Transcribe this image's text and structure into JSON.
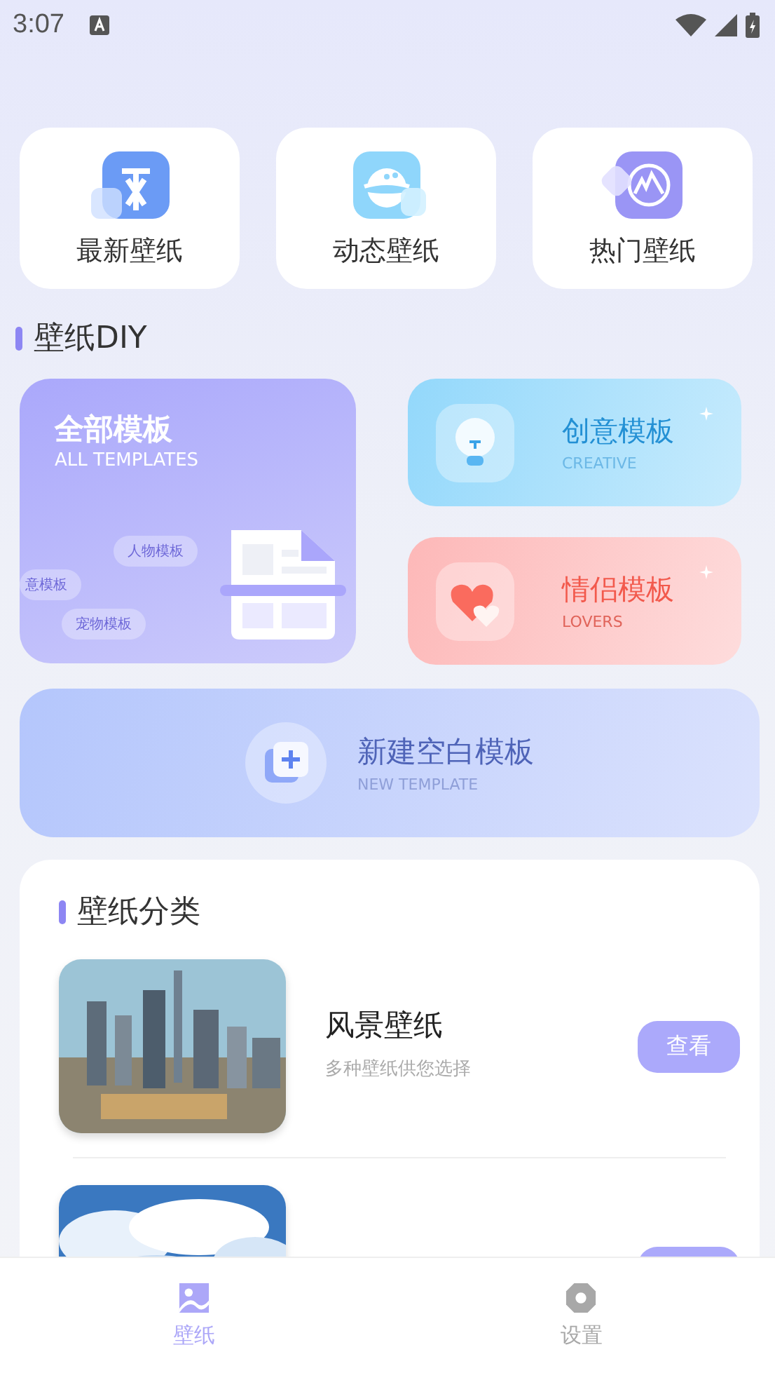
{
  "status_bar": {
    "time": "3:07"
  },
  "quick_entries": [
    {
      "label": "最新壁纸",
      "kind": "new"
    },
    {
      "label": "动态壁纸",
      "kind": "planet"
    },
    {
      "label": "热门壁纸",
      "kind": "hot"
    }
  ],
  "diy": {
    "title": "壁纸DIY",
    "all_templates": {
      "title": "全部模板",
      "subtitle": "ALL TEMPLATES",
      "tags": [
        "人物模板",
        "意模板",
        "宠物模板"
      ]
    },
    "side_cards": [
      {
        "title": "创意模板",
        "subtitle": "CREATIVE",
        "kind": "creative"
      },
      {
        "title": "情侣模板",
        "subtitle": "LOVERS",
        "kind": "lovers"
      }
    ],
    "new_template": {
      "title": "新建空白模板",
      "subtitle": "NEW TEMPLATE"
    }
  },
  "categories": {
    "title": "壁纸分类",
    "items": [
      {
        "name": "风景壁纸",
        "description": "多种壁纸供您选择",
        "button": "查看",
        "kind": "city"
      },
      {
        "kind": "sky"
      }
    ]
  },
  "tab_bar": [
    {
      "label": "壁纸",
      "kind": "wallpaper",
      "selected": true
    },
    {
      "label": "设置",
      "kind": "settings",
      "selected": false
    }
  ]
}
